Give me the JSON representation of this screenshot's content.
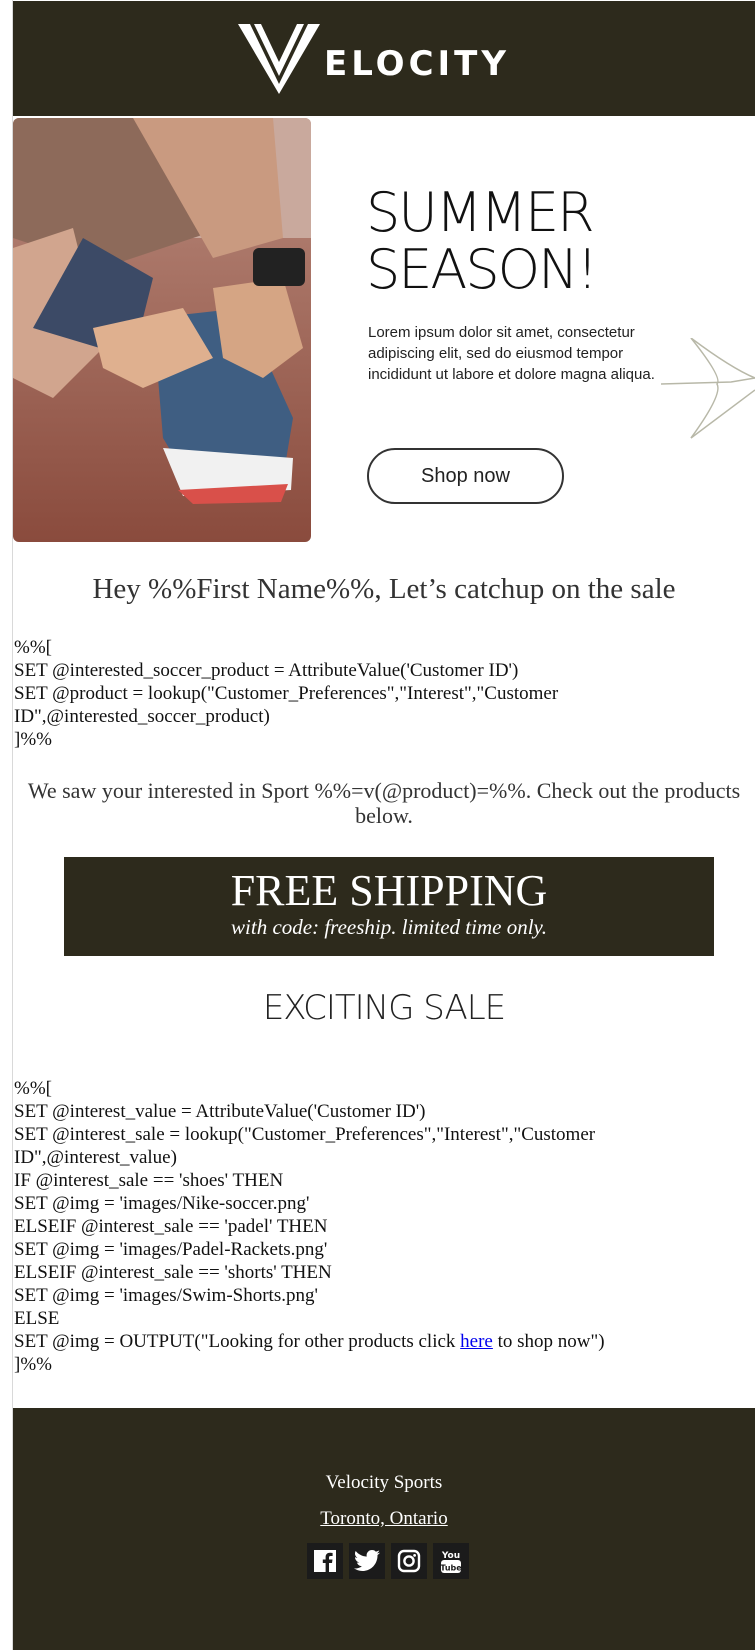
{
  "header": {
    "brand": "ELOCITY",
    "logo_icon": "velocity-v-logo-icon"
  },
  "hero": {
    "title_line1": "SUMMER",
    "title_line2": "SEASON!",
    "copy": "Lorem ipsum dolor sit amet, consectetur adipiscing elit, sed do eiusmod tempor incididunt ut labore et dolore magna aliqua.",
    "cta_label": "Shop now",
    "photo_icon": "shoe-lacing-photo"
  },
  "greeting": "Hey %%First Name%%, Let’s catchup on the sale",
  "code_block_1": [
    "%%[",
    "SET @interested_soccer_product = AttributeValue('Customer ID')",
    "SET @product = lookup(\"Customer_Preferences\",\"Interest\",\"Customer ID\",@interested_soccer_product)",
    "]%%"
  ],
  "interest_text": "We saw your interested in Sport %%=v(@product)=%%. Check out the products below.",
  "shipping": {
    "title": "FREE SHIPPING",
    "subtitle": "with code: freeship. limited time only."
  },
  "sale_heading": "EXCITING SALE",
  "code_block_2": [
    "%%[",
    "SET @interest_value = AttributeValue('Customer ID')",
    "SET @interest_sale = lookup(\"Customer_Preferences\",\"Interest\",\"Customer ID\",@interest_value)",
    "IF @interest_sale == 'shoes' THEN",
    "SET @img = 'images/Nike-soccer.png'",
    "ELSEIF @interest_sale == 'padel' THEN",
    "SET @img = 'images/Padel-Rackets.png'",
    "ELSEIF @interest_sale == 'shorts' THEN",
    "SET @img = 'images/Swim-Shorts.png'",
    "ELSE"
  ],
  "output_line": {
    "before": "SET @img = OUTPUT(\"Looking for other products click ",
    "link": "here",
    "after": " to shop now\")"
  },
  "code_block_2_end": "]%%",
  "footer": {
    "company": "Velocity Sports",
    "location": "Toronto, Ontario",
    "socials": [
      "facebook-icon",
      "twitter-icon",
      "instagram-icon",
      "youtube-icon"
    ]
  },
  "colors": {
    "dark": "#2d2a1c",
    "link": "#0000ee"
  }
}
